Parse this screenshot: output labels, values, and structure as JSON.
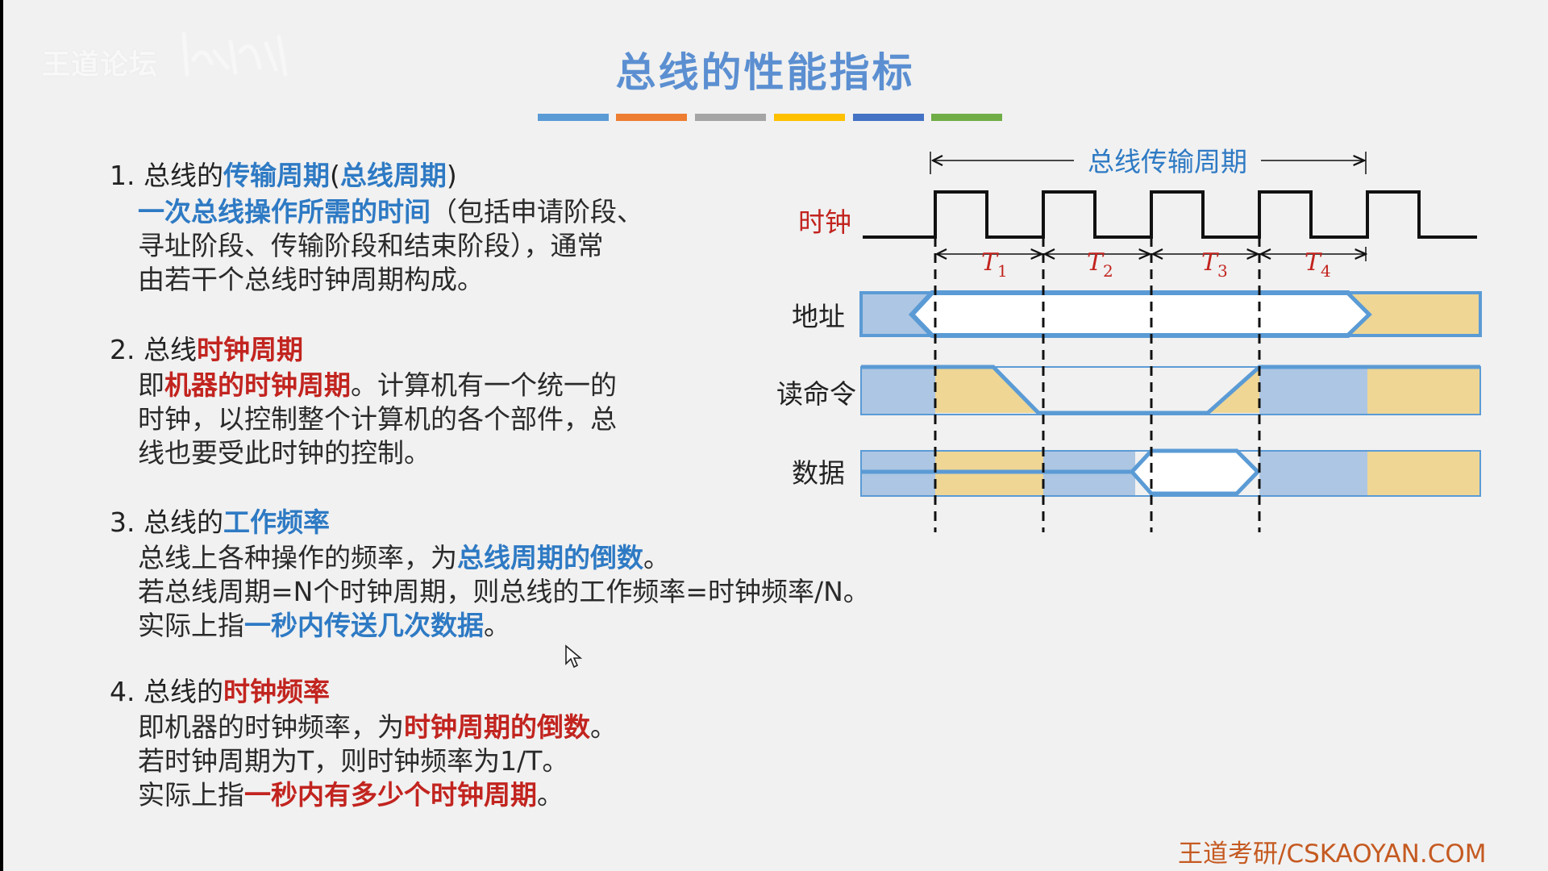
{
  "watermark": "王道论坛",
  "title": "总线的性能指标",
  "title_bar_colors": [
    "#5b9bd5",
    "#ed7d31",
    "#a5a5a5",
    "#ffc000",
    "#4472c4",
    "#70ad47"
  ],
  "items": [
    {
      "head": {
        "prefix": "1. 总线的",
        "hl1": "传输周期",
        "mid": "(",
        "hl2": "总线周期",
        "suffix": ")"
      },
      "body": [
        {
          "hl": "一次总线操作所需的时间",
          "rest": "（包括申请阶段、"
        },
        {
          "text": "寻址阶段、传输阶段和结束阶段），通常"
        },
        {
          "text": "由若干个总线时钟周期构成。"
        }
      ]
    },
    {
      "head": {
        "prefix": "2. 总线",
        "hl1": "时钟周期"
      },
      "body": [
        {
          "pre": "即",
          "hl": "机器的时钟周期",
          "rest": "。计算机有一个统一的"
        },
        {
          "text": "时钟，以控制整个计算机的各个部件，总"
        },
        {
          "text": "线也要受此时钟的控制。"
        }
      ]
    },
    {
      "head": {
        "prefix": "3. 总线的",
        "hl1": "工作频率"
      },
      "body": [
        {
          "pre": "总线上各种操作的频率，为",
          "hl": "总线周期的倒数",
          "rest": "。"
        },
        {
          "text": "若总线周期=N个时钟周期，则总线的工作频率=时钟频率/N。"
        },
        {
          "pre": "实际上指",
          "hl": "一秒内传送几次数据",
          "rest": "。"
        }
      ]
    },
    {
      "head": {
        "prefix": "4. 总线的",
        "hl1": "时钟频率"
      },
      "body": [
        {
          "pre": "即机器的时钟频率，为",
          "hl": "时钟周期的倒数",
          "rest": "。"
        },
        {
          "text": "若时钟周期为T，则时钟频率为1/T。"
        },
        {
          "pre": "实际上指",
          "hl": "一秒内有多少个时钟周期",
          "rest": "。"
        }
      ]
    }
  ],
  "diagram": {
    "bus_cycle_label": "总线传输周期",
    "clock_label": "时钟",
    "address_label": "地址",
    "read_label": "读命令",
    "data_label": "数据",
    "periods": [
      "T",
      "T",
      "T",
      "T"
    ],
    "period_subs": [
      "1",
      "2",
      "3",
      "4"
    ],
    "colors": {
      "blue_fill": "#adc6e3",
      "yellow_fill": "#efd695",
      "blue_line": "#5b9bd5",
      "label_red": "#c2241f",
      "label_blue": "#2e7ac4"
    }
  },
  "footer": "王道考研/CSKAOYAN.COM"
}
